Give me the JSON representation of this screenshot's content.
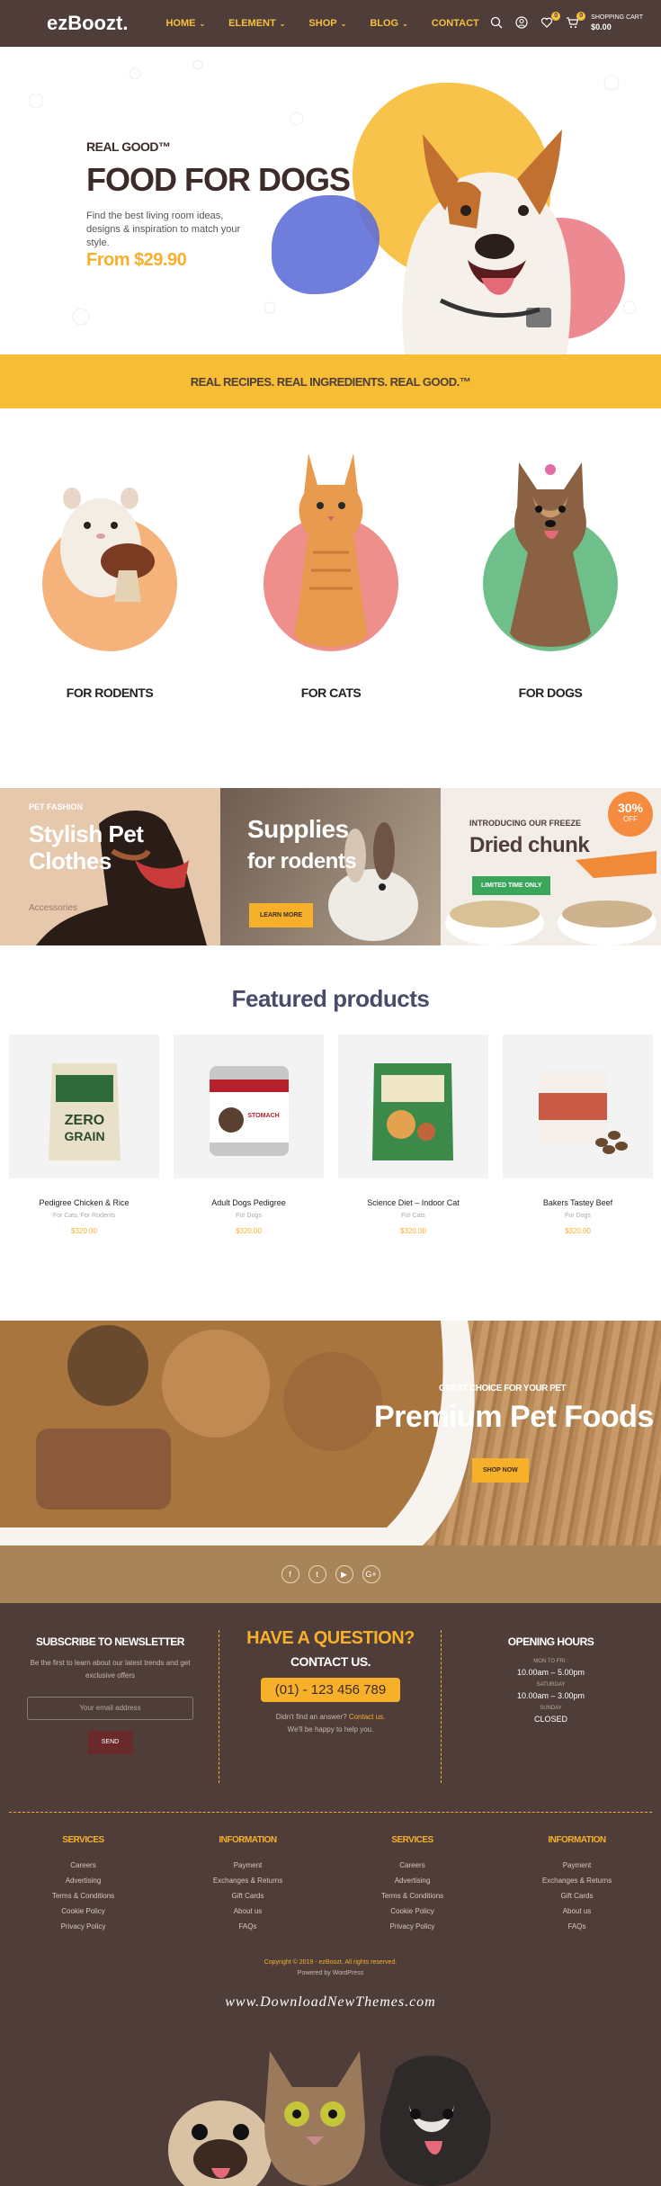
{
  "header": {
    "logo": "ezBoozt.",
    "nav": [
      {
        "label": "HOME",
        "dropdown": true
      },
      {
        "label": "ELEMENT",
        "dropdown": true
      },
      {
        "label": "SHOP",
        "dropdown": true
      },
      {
        "label": "BLOG",
        "dropdown": true
      },
      {
        "label": "CONTACT",
        "dropdown": false
      }
    ],
    "wishlist_count": "0",
    "cart_count": "0",
    "cart_label": "SHOPPING CART",
    "cart_total": "$0.00",
    "accent": "#f6c03c",
    "bg": "#4f3d3a"
  },
  "hero": {
    "subtitle": "REAL GOOD™",
    "title": "FOOD FOR DOGS",
    "description": "Find the best living room ideas, designs & inspiration to match your style.",
    "price": "From $29.90"
  },
  "strip": {
    "text": "REAL RECIPES. REAL INGREDIENTS. REAL GOOD.™"
  },
  "categories": [
    {
      "label": "FOR RODENTS",
      "color": "#f5b27a"
    },
    {
      "label": "FOR CATS",
      "color": "#ef8f8c"
    },
    {
      "label": "FOR DOGS",
      "color": "#6fbf8a"
    }
  ],
  "promos": [
    {
      "kicker": "PET FASHION",
      "title": "Stylish Pet Clothes",
      "link": "Accessories"
    },
    {
      "title_line1": "Supplies",
      "title_line2": "for rodents",
      "button": "LEARN MORE"
    },
    {
      "kicker": "INTRODUCING OUR FREEZE",
      "title": "Dried chunk",
      "badge": "LIMITED TIME ONLY",
      "discount": "30%",
      "discount_label": "OFF"
    }
  ],
  "featured": {
    "title": "Featured products",
    "products": [
      {
        "name": "Pedigree Chicken & Rice",
        "category": "For Cats, For Rodents",
        "price": "$320.00"
      },
      {
        "name": "Adult Dogs Pedigree",
        "category": "For Dogs",
        "price": "$320.00"
      },
      {
        "name": "Science Diet – Indoor Cat",
        "category": "For Cats",
        "price": "$320.00"
      },
      {
        "name": "Bakers Tastey Beef",
        "category": "For Dogs",
        "price": "$320.00"
      }
    ]
  },
  "premium": {
    "kicker": "GREAT CHOICE FOR YOUR PET",
    "title": "Premium Pet Foods",
    "button": "SHOP NOW"
  },
  "social": [
    "f",
    "t",
    "▶",
    "G+"
  ],
  "footer": {
    "newsletter": {
      "title": "SUBSCRIBE TO NEWSLETTER",
      "text": "Be the first to learn about our latest trends and get exclusive offers",
      "placeholder": "Your email address",
      "button": "SEND"
    },
    "question": {
      "title": "HAVE A QUESTION?",
      "subtitle": "CONTACT US.",
      "phone": "(01) - 123 456 789",
      "text1": "Didn't find an answer?",
      "link": "Contact us.",
      "text2": "We'll be happy to help you."
    },
    "hours": {
      "title": "OPENING HOURS",
      "l1": "MON TO FRI :",
      "v1": "10.00am – 5.00pm",
      "l2": "SATURDAY",
      "v2": "10.00am – 3.00pm",
      "l3": "SUNDAY",
      "v3": "CLOSED"
    },
    "columns": [
      {
        "title": "SERVICES",
        "links": [
          "Careers",
          "Advertising",
          "Terms & Conditions",
          "Cookie Policy",
          "Privacy Policy"
        ]
      },
      {
        "title": "INFORMATION",
        "links": [
          "Payment",
          "Exchanges & Returns",
          "Gift Cards",
          "About us",
          "FAQs"
        ]
      },
      {
        "title": "SERVICES",
        "links": [
          "Careers",
          "Advertising",
          "Terms & Conditions",
          "Cookie Policy",
          "Privacy Policy"
        ]
      },
      {
        "title": "INFORMATION",
        "links": [
          "Payment",
          "Exchanges & Returns",
          "Gift Cards",
          "About us",
          "FAQs"
        ]
      }
    ],
    "copyright": "Copyright © 2019 - ezBoozt. All rights reserved.",
    "powered": "Powered by WordPress",
    "watermark": "www.DownloadNewThemes.com"
  }
}
